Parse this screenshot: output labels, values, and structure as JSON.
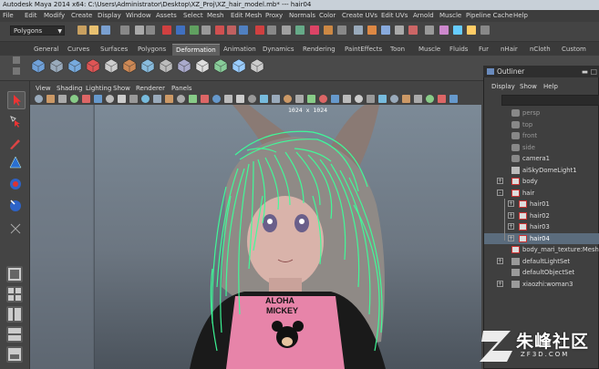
{
  "window": {
    "title": "Autodesk Maya 2014 x64: C:\\Users\\Administrator\\Desktop\\XZ_Proj\\XZ_hair_model.mb*  ---  hair04"
  },
  "menubar": {
    "items": [
      "File",
      "Edit",
      "Modify",
      "Create",
      "Display",
      "Window",
      "Assets",
      "Select",
      "Mesh",
      "Edit Mesh",
      "Proxy",
      "Normals",
      "Color",
      "Create UVs",
      "Edit UVs",
      "Arnold",
      "Muscle",
      "Pipeline Cache",
      "Help"
    ]
  },
  "toolbar": {
    "mode_select": "Polygons"
  },
  "shelf": {
    "tabs": [
      "General",
      "Curves",
      "Surfaces",
      "Polygons",
      "Deformation",
      "Animation",
      "Dynamics",
      "Rendering",
      "PaintEffects",
      "Toon",
      "Muscle",
      "Fluids",
      "Fur",
      "nHair",
      "nCloth",
      "Custom"
    ],
    "active_tab": "Deformation"
  },
  "panel": {
    "menus": [
      "View",
      "Shading",
      "Lighting",
      "Show",
      "Renderer",
      "Panels"
    ]
  },
  "viewport": {
    "resolution_gate": "1024 x 1024",
    "shirt_text_line1": "ALOHA",
    "shirt_text_line2": "MICKEY"
  },
  "outliner": {
    "title": "Outliner",
    "menus": [
      "Display",
      "Show",
      "Help"
    ],
    "items": [
      {
        "label": "persp",
        "indent": 0,
        "icon": "camera-icon",
        "dim": true,
        "expand": ""
      },
      {
        "label": "top",
        "indent": 0,
        "icon": "camera-icon",
        "dim": true,
        "expand": ""
      },
      {
        "label": "front",
        "indent": 0,
        "icon": "camera-icon",
        "dim": true,
        "expand": ""
      },
      {
        "label": "side",
        "indent": 0,
        "icon": "camera-icon",
        "dim": true,
        "expand": ""
      },
      {
        "label": "camera1",
        "indent": 0,
        "icon": "camera-icon",
        "dim": false,
        "expand": ""
      },
      {
        "label": "aiSkyDomeLight1",
        "indent": 0,
        "icon": "light-icon",
        "dim": false,
        "expand": ""
      },
      {
        "label": "body",
        "indent": 0,
        "icon": "mesh-icon",
        "dim": false,
        "expand": "+"
      },
      {
        "label": "hair",
        "indent": 0,
        "icon": "mesh-icon",
        "dim": false,
        "expand": "-"
      },
      {
        "label": "hair01",
        "indent": 1,
        "icon": "mesh-icon",
        "dim": false,
        "expand": "+"
      },
      {
        "label": "hair02",
        "indent": 1,
        "icon": "mesh-icon",
        "dim": false,
        "expand": "+"
      },
      {
        "label": "hair03",
        "indent": 1,
        "icon": "mesh-icon",
        "dim": false,
        "expand": "+"
      },
      {
        "label": "hair04",
        "indent": 1,
        "icon": "mesh-icon",
        "dim": false,
        "expand": "+",
        "selected": true
      },
      {
        "label": "body_mari_texture:Mesh",
        "indent": 0,
        "icon": "mesh-icon",
        "dim": false,
        "expand": ""
      },
      {
        "label": "defaultLightSet",
        "indent": 0,
        "icon": "set-icon",
        "dim": false,
        "expand": "+"
      },
      {
        "label": "defaultObjectSet",
        "indent": 0,
        "icon": "set-icon",
        "dim": false,
        "expand": ""
      },
      {
        "label": "xiaozhi:woman3",
        "indent": 0,
        "icon": "set-icon",
        "dim": false,
        "expand": "+"
      }
    ]
  },
  "watermark": {
    "text": "朱峰社区",
    "sub": "ZF3D.COM"
  },
  "colors": {
    "hair_wire": "#3dff9a",
    "selection": "#5b6c7d",
    "accent_red": "#d33"
  }
}
